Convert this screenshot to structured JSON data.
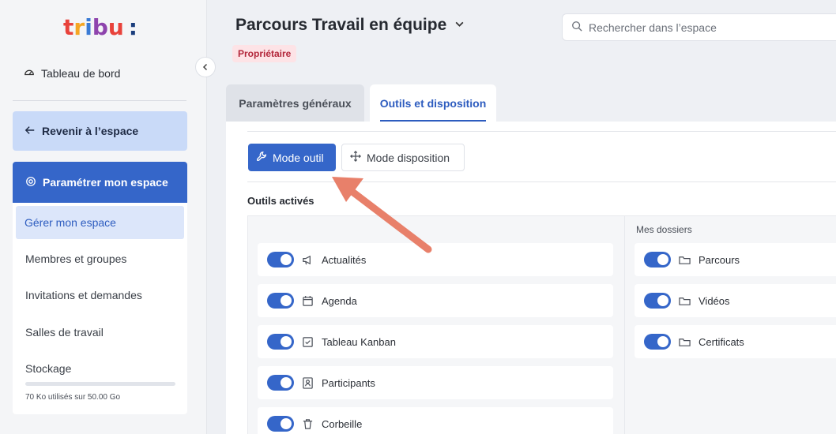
{
  "logo": {
    "text_parts": [
      "t",
      "r",
      "i",
      "b",
      "u",
      ":"
    ]
  },
  "sidebar": {
    "dashboard_label": "Tableau de bord",
    "back_label": "Revenir à l’espace",
    "params_label": "Paramétrer mon espace",
    "submenu": [
      {
        "label": "Gérer mon espace",
        "active": true
      },
      {
        "label": "Membres et groupes"
      },
      {
        "label": "Invitations et demandes"
      },
      {
        "label": "Salles de travail"
      },
      {
        "label": "Stockage"
      }
    ],
    "storage_text": "70 Ko utilisés sur 50.00 Go",
    "storage_used_fraction": 0.0
  },
  "header": {
    "title": "Parcours Travail en équipe",
    "badge": "Propriétaire",
    "search_placeholder": "Rechercher dans l’espace"
  },
  "tabs": [
    {
      "label": "Paramètres généraux",
      "active": false
    },
    {
      "label": "Outils et disposition",
      "active": true
    }
  ],
  "modes": [
    {
      "label": "Mode outil",
      "icon": "wrench-icon",
      "active": true
    },
    {
      "label": "Mode disposition",
      "icon": "move-icon",
      "active": false
    }
  ],
  "tools_section_title": "Outils activés",
  "tools": [
    {
      "label": "Actualités",
      "icon": "megaphone-icon",
      "enabled": true
    },
    {
      "label": "Agenda",
      "icon": "calendar-icon",
      "enabled": true
    },
    {
      "label": "Tableau Kanban",
      "icon": "checkbox-icon",
      "enabled": true
    },
    {
      "label": "Participants",
      "icon": "contact-icon",
      "enabled": true
    },
    {
      "label": "Corbeille",
      "icon": "trash-icon",
      "enabled": true
    }
  ],
  "folders_title": "Mes dossiers",
  "folders": [
    {
      "label": "Parcours",
      "icon": "folder-icon",
      "enabled": true
    },
    {
      "label": "Vidéos",
      "icon": "folder-icon",
      "enabled": true
    },
    {
      "label": "Certificats",
      "icon": "folder-icon",
      "enabled": true
    }
  ],
  "colors": {
    "accent": "#3566c9",
    "badge_bg": "#fde3e6",
    "badge_text": "#b2263a",
    "annotation_arrow": "#e8806a"
  }
}
